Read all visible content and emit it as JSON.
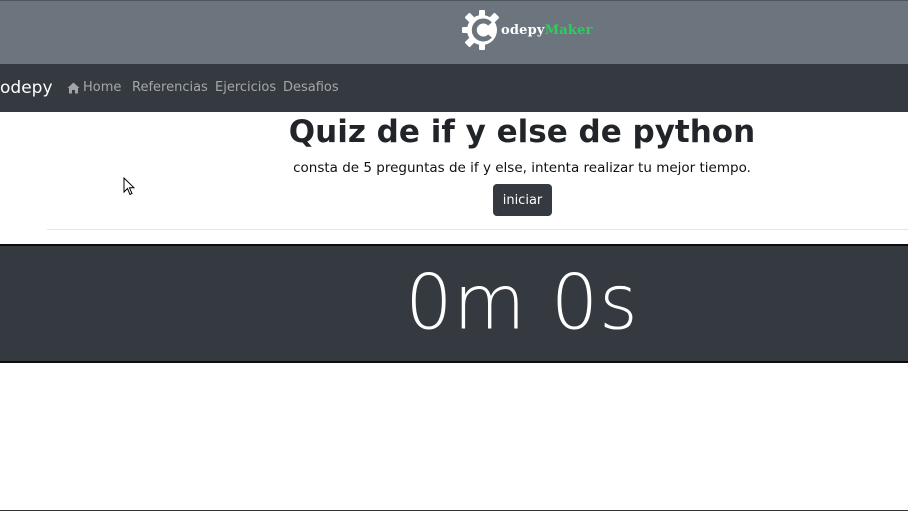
{
  "header": {
    "logo": {
      "icon": "gear-c-icon",
      "text_primary": "odepy",
      "text_accent": "Maker",
      "accent_color": "#28d05a"
    }
  },
  "navbar": {
    "brand": "odepy",
    "links": [
      {
        "label": "Home",
        "icon": "home-icon"
      },
      {
        "label": "Referencias"
      },
      {
        "label": "Ejercicios"
      },
      {
        "label": "Desafios"
      }
    ]
  },
  "quiz": {
    "title": "Quiz de if y else de python",
    "subtitle": "consta de 5 preguntas de if y else, intenta realizar tu mejor tiempo.",
    "start_label": "iniciar"
  },
  "timer": {
    "display": "0m 0s"
  }
}
